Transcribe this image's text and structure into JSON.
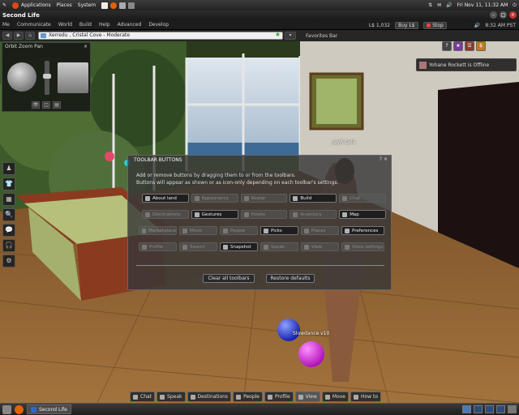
{
  "os_panel": {
    "menus": [
      "Applications",
      "Places",
      "System"
    ],
    "clock": "Fri Nov 11, 11:32 AM",
    "colors": {
      "ubuntu": "#dd4814",
      "firefox": "#e66000"
    }
  },
  "window": {
    "title": "Second Life",
    "controls": [
      "–",
      "□",
      "×"
    ]
  },
  "menubar": {
    "items": [
      "Me",
      "Communicate",
      "World",
      "Build",
      "Help",
      "Advanced",
      "Develop"
    ],
    "balance": "L$ 1,032",
    "buy_label": "Buy L$",
    "stop_label": "Stop",
    "time": "8:32 AM PST"
  },
  "navbar": {
    "back": "◀",
    "forward": "▶",
    "home": "⌂",
    "location": "Xerredu , Cristal Cove - Moderate",
    "go": "▾",
    "favorites_label": "Favorites Bar"
  },
  "camera": {
    "title": "Orbit Zoom Pan",
    "close": "×",
    "modes": [
      "👁",
      "◫",
      "▤"
    ]
  },
  "notice": {
    "text": "Yohane Rockett is Offline"
  },
  "right_tools": [
    "?",
    "★",
    "☰",
    "$"
  ],
  "left_toolbar": {
    "icons": [
      "person-icon",
      "shirt-icon",
      "inventory-icon",
      "search-icon",
      "chat-icon",
      "headset-icon",
      "settings-icon"
    ],
    "glyphs": [
      "♟",
      "👕",
      "▦",
      "🔍",
      "💬",
      "🎧",
      "⚙"
    ]
  },
  "scene": {
    "nametag_jayr": "JayR Cela",
    "nametag_slowdance": "Slowdance v10"
  },
  "toolbar_dialog": {
    "title": "TOOLBAR BUTTONS",
    "controls": "? ×",
    "hint1": "Add or remove buttons by dragging them to or from the toolbars.",
    "hint2": "Buttons will appear as shown or as icon-only depending on each toolbar's settings.",
    "rows": [
      [
        {
          "label": "About land",
          "on": true
        },
        {
          "label": "Appearance",
          "on": false
        },
        {
          "label": "Avatar",
          "on": false
        },
        {
          "label": "Build",
          "on": true
        },
        {
          "label": "Chat",
          "on": false
        }
      ],
      [
        {
          "label": "Destinations",
          "on": false
        },
        {
          "label": "Gestures",
          "on": true
        },
        {
          "label": "Howto",
          "on": false
        },
        {
          "label": "Inventory",
          "on": false
        },
        {
          "label": "Map",
          "on": true
        }
      ],
      [
        {
          "label": "Marketplace",
          "on": false
        },
        {
          "label": "Move",
          "on": false
        },
        {
          "label": "People",
          "on": false
        },
        {
          "label": "Picks",
          "on": true
        },
        {
          "label": "Places",
          "on": false
        },
        {
          "label": "Preferences",
          "on": true
        }
      ],
      [
        {
          "label": "Profile",
          "on": false
        },
        {
          "label": "Search",
          "on": false
        },
        {
          "label": "Snapshot",
          "on": true
        },
        {
          "label": "Speak",
          "on": false
        },
        {
          "label": "View",
          "on": false
        },
        {
          "label": "Voice settings",
          "on": false
        }
      ]
    ],
    "clear_label": "Clear all toolbars",
    "restore_label": "Restore defaults"
  },
  "bottom_toolbar": [
    "Chat",
    "Speak",
    "Destinations",
    "People",
    "Profile",
    "View",
    "Move",
    "How to"
  ],
  "taskbar": {
    "task_label": "Second Life"
  }
}
